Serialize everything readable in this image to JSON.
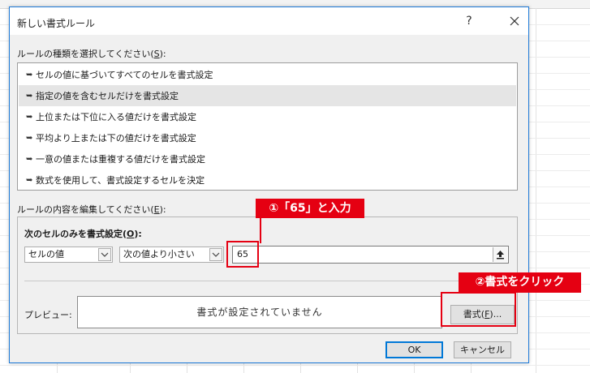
{
  "colors": {
    "accent": "#0078d7",
    "callout_red": "#e50012",
    "selected_row": "#e5e5e5",
    "dialog_bg": "#f0f0f0"
  },
  "dialog": {
    "title": "新しい書式ルール",
    "help_label": "?",
    "close_icon": "close-icon"
  },
  "rule_type": {
    "label_prefix": "ルールの種類を選択してください(",
    "label_key": "S",
    "label_suffix": "):",
    "items": [
      {
        "label": "セルの値に基づいてすべてのセルを書式設定",
        "selected": false
      },
      {
        "label": "指定の値を含むセルだけを書式設定",
        "selected": true
      },
      {
        "label": "上位または下位に入る値だけを書式設定",
        "selected": false
      },
      {
        "label": "平均より上または下の値だけを書式設定",
        "selected": false
      },
      {
        "label": "一意の値または重複する値だけを書式設定",
        "selected": false
      },
      {
        "label": "数式を使用して、書式設定するセルを決定",
        "selected": false
      }
    ],
    "bullet": "➥"
  },
  "rule_edit": {
    "label_prefix": "ルールの内容を編集してください(",
    "label_key": "E",
    "label_suffix": "):",
    "condition_label_prefix": "次のセルのみを書式設定(",
    "condition_label_key": "O",
    "condition_label_suffix": "):",
    "field_select": "セルの値",
    "operator_select": "次の値より小さい",
    "value": "65",
    "preview_label": "プレビュー:",
    "preview_text": "書式が設定されていません",
    "format_button_prefix": "書式(",
    "format_button_key": "F",
    "format_button_suffix": ")..."
  },
  "buttons": {
    "ok": "OK",
    "cancel": "キャンセル"
  },
  "annotations": {
    "step1": "①「65」と入力",
    "step2": "②書式をクリック"
  }
}
